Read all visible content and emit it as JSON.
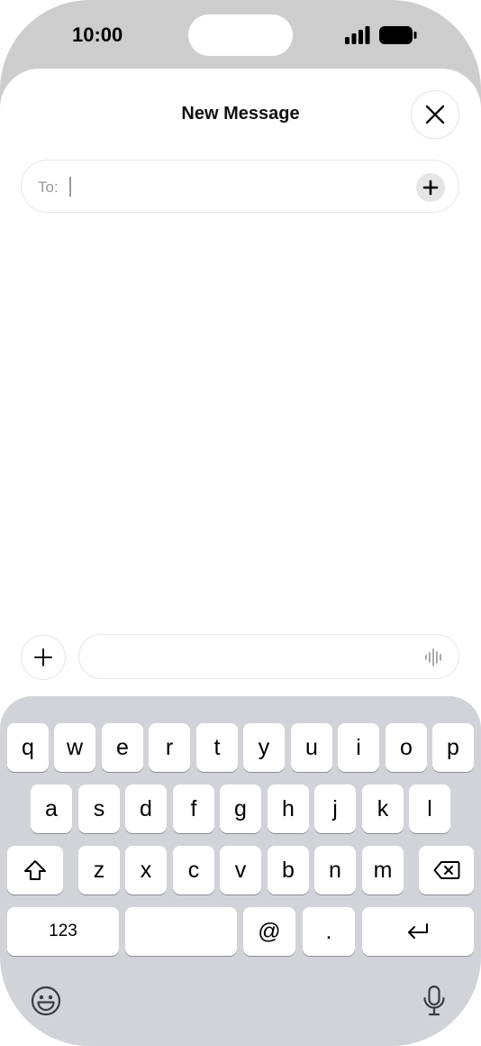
{
  "status_bar": {
    "time": "10:00"
  },
  "sheet": {
    "title": "New Message",
    "to_label": "To:"
  },
  "icons": {
    "close": "close-icon",
    "add_recipient": "plus-icon",
    "compose_add": "plus-icon",
    "voice": "waveform-icon",
    "shift": "shift-icon",
    "delete": "backspace-icon",
    "return": "return-icon",
    "emoji": "emoji-icon",
    "dictation": "microphone-icon"
  },
  "keyboard": {
    "row1": [
      "q",
      "w",
      "e",
      "r",
      "t",
      "y",
      "u",
      "i",
      "o",
      "p"
    ],
    "row2": [
      "a",
      "s",
      "d",
      "f",
      "g",
      "h",
      "j",
      "k",
      "l"
    ],
    "row3": [
      "z",
      "x",
      "c",
      "v",
      "b",
      "n",
      "m"
    ],
    "numbers_label": "123",
    "at_label": "@",
    "dot_label": "."
  },
  "colors": {
    "keyboard_bg": "#d1d3d9",
    "key_bg": "#ffffff",
    "frame": "#cdcdcd"
  }
}
